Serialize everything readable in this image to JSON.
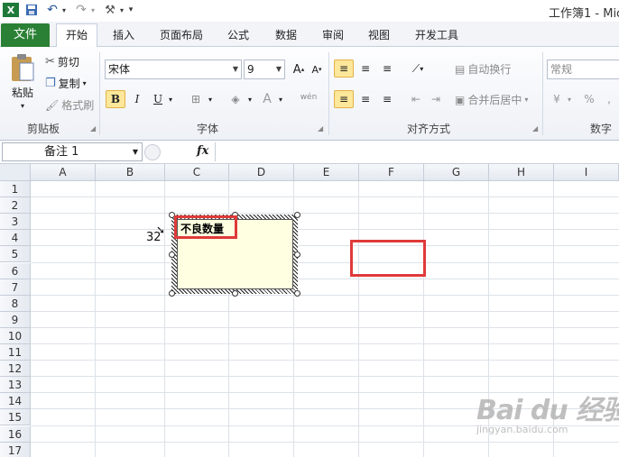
{
  "window": {
    "title": "工作簿1 - Mic"
  },
  "tabs": {
    "file": "文件",
    "items": [
      "开始",
      "插入",
      "页面布局",
      "公式",
      "数据",
      "审阅",
      "视图",
      "开发工具"
    ]
  },
  "ribbon": {
    "clipboard": {
      "paste": "粘贴",
      "cut": "剪切",
      "copy": "复制",
      "format_painter": "格式刷",
      "label": "剪贴板"
    },
    "font": {
      "name": "宋体",
      "size": "9",
      "bold": "B",
      "italic": "I",
      "underline": "U",
      "font_color_glyph": "A",
      "phonetic_glyph": "wén",
      "label": "字体"
    },
    "alignment": {
      "wrap_text": "自动换行",
      "merge_center": "合并后居中",
      "label": "对齐方式"
    },
    "number": {
      "format": "常规",
      "percent": "%",
      "label": "数字"
    }
  },
  "formula_bar": {
    "name_box": "备注 1",
    "fx": "fx",
    "value": ""
  },
  "grid": {
    "columns": [
      "A",
      "B",
      "C",
      "D",
      "E",
      "F",
      "G",
      "H",
      "I"
    ],
    "rows": [
      "1",
      "2",
      "3",
      "4",
      "5",
      "6",
      "7",
      "8",
      "9",
      "10",
      "11",
      "12",
      "13",
      "14",
      "15",
      "16",
      "17"
    ],
    "cell_value": "32"
  },
  "comment": {
    "text": "不良数量"
  },
  "watermark": {
    "main": "Bai du 经验",
    "sub": "jingyan.baidu.com"
  }
}
